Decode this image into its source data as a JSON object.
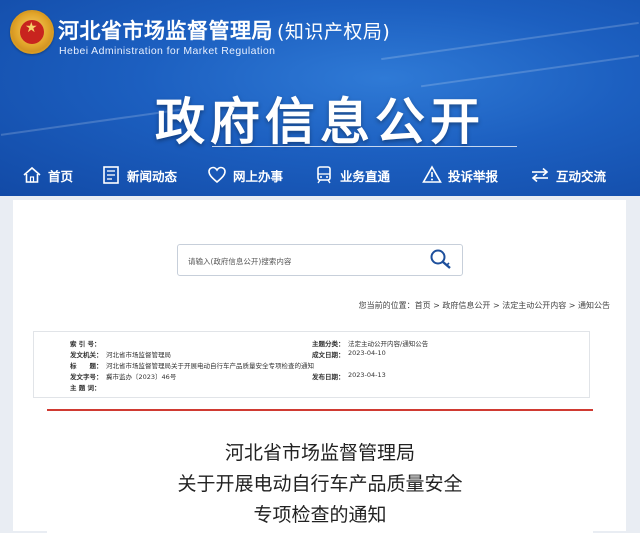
{
  "header": {
    "org_name": "河北省市场监督管理局",
    "org_sub": "(知识产权局)",
    "org_en": "Hebei Administration for Market Regulation",
    "big_title": "政府信息公开"
  },
  "nav": {
    "items": [
      {
        "label": "首页",
        "icon": "home-icon"
      },
      {
        "label": "新闻动态",
        "icon": "news-icon"
      },
      {
        "label": "网上办事",
        "icon": "heart-icon"
      },
      {
        "label": "业务直通",
        "icon": "train-icon"
      },
      {
        "label": "投诉举报",
        "icon": "warning-icon"
      },
      {
        "label": "互动交流",
        "icon": "exchange-icon"
      }
    ]
  },
  "search": {
    "placeholder": "请输入(政府信息公开)搜索内容"
  },
  "breadcrumb": "您当前的位置：首页 > 政府信息公开 > 法定主动公开内容 > 通知公告",
  "meta": {
    "index_key": "索 引 号：",
    "index_val": "",
    "category_key": "主题分类：",
    "category_val": "法定主动公开内容/通知公告",
    "issuer_key": "发文机关：",
    "issuer_val": "河北省市场监督管理局",
    "created_key": "成文日期：",
    "created_val": "2023-04-10",
    "title_key": "标　　题：",
    "title_val": "河北省市场监督管理局关于开展电动自行车产品质量安全专项检查的通知",
    "docno_key": "发文字号：",
    "docno_val": "冀市监办〔2023〕46号",
    "published_key": "发布日期：",
    "published_val": "2023-04-13",
    "keywords_key": "主 题 词：",
    "keywords_val": ""
  },
  "document": {
    "title_line1": "河北省市场监督管理局",
    "title_line2": "关于开展电动自行车产品质量安全",
    "title_line3": "专项检查的通知"
  },
  "colors": {
    "header_blue": "#1c5fc0",
    "accent_red": "#d03a32"
  }
}
